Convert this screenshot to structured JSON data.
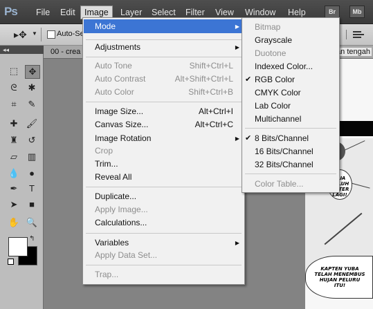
{
  "app": {
    "logo": "Ps"
  },
  "menubar": {
    "items": [
      "File",
      "Edit",
      "Image",
      "Layer",
      "Select",
      "Filter",
      "View",
      "Window",
      "Help"
    ],
    "active": "Image",
    "bridge_badge": "Br",
    "minibridge_badge": "Mb"
  },
  "options_bar": {
    "tool_icon": "move-tool-icon",
    "autoselect_label": "Auto-Se",
    "autoselect_checked": false
  },
  "document": {
    "tab_label": "00 - crea",
    "tab_label_right": "an tengah"
  },
  "manga_text": {
    "balloon1": "DUA PULUH METER LAGI!",
    "balloon2": "KAPTEN YUBA TELAH MENEMBUS HUJAN PELURU ITU!"
  },
  "image_menu": {
    "mode": "Mode",
    "adjustments": "Adjustments",
    "auto_tone": "Auto Tone",
    "auto_tone_sc": "Shift+Ctrl+L",
    "auto_contrast": "Auto Contrast",
    "auto_contrast_sc": "Alt+Shift+Ctrl+L",
    "auto_color": "Auto Color",
    "auto_color_sc": "Shift+Ctrl+B",
    "image_size": "Image Size...",
    "image_size_sc": "Alt+Ctrl+I",
    "canvas_size": "Canvas Size...",
    "canvas_size_sc": "Alt+Ctrl+C",
    "image_rotation": "Image Rotation",
    "crop": "Crop",
    "trim": "Trim...",
    "reveal_all": "Reveal All",
    "duplicate": "Duplicate...",
    "apply_image": "Apply Image...",
    "calculations": "Calculations...",
    "variables": "Variables",
    "apply_data_set": "Apply Data Set...",
    "trap": "Trap..."
  },
  "mode_menu": {
    "bitmap": "Bitmap",
    "grayscale": "Grayscale",
    "duotone": "Duotone",
    "indexed_color": "Indexed Color...",
    "rgb_color": "RGB Color",
    "cmyk_color": "CMYK Color",
    "lab_color": "Lab Color",
    "multichannel": "Multichannel",
    "bits8": "8 Bits/Channel",
    "bits16": "16 Bits/Channel",
    "bits32": "32 Bits/Channel",
    "color_table": "Color Table...",
    "checked": [
      "RGB Color",
      "8 Bits/Channel"
    ]
  },
  "colors": {
    "menu_highlight": "#3c75d4",
    "foreground": "#ffffff",
    "background": "#000000"
  }
}
